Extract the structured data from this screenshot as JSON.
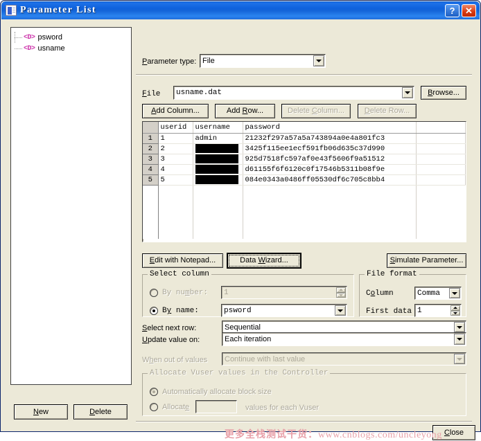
{
  "window": {
    "title": "Parameter List",
    "icon": "document-icon",
    "help_button": "?",
    "close_button": "✕"
  },
  "tree": {
    "items": [
      {
        "icon": "<D>",
        "label": "psword"
      },
      {
        "icon": "<D>",
        "label": "usname"
      }
    ]
  },
  "left_buttons": {
    "new": {
      "label": "New",
      "accel": "N",
      "enabled": true
    },
    "delete": {
      "label": "Delete",
      "accel": "D",
      "enabled": true
    }
  },
  "parameter_type": {
    "label": "Parameter type:",
    "accel": "P",
    "value": "File"
  },
  "file_row": {
    "label": "File",
    "accel": "F",
    "value": "usname.dat",
    "browse": {
      "label": "Browse...",
      "accel": "B"
    }
  },
  "grid_buttons": [
    {
      "label": "Add Column...",
      "accel": "A",
      "enabled": true
    },
    {
      "label": "Add Row...",
      "accel": "R",
      "enabled": true
    },
    {
      "label": "Delete Column...",
      "accel": "C",
      "enabled": false
    },
    {
      "label": "Delete Row...",
      "accel": "D",
      "enabled": false
    }
  ],
  "grid": {
    "columns": [
      "userid",
      "username",
      "password"
    ],
    "rows": [
      {
        "num": "1",
        "userid": "1",
        "username": "admin",
        "username_redacted": false,
        "password": "21232f297a57a5a743894a0e4a801fc3"
      },
      {
        "num": "2",
        "userid": "2",
        "username": "",
        "username_redacted": true,
        "password": "3425f115ee1ecf591fb06d635c37d990"
      },
      {
        "num": "3",
        "userid": "3",
        "username": "",
        "username_redacted": true,
        "password": "925d7518fc597af0e43f5606f9a51512"
      },
      {
        "num": "4",
        "userid": "4",
        "username": "",
        "username_redacted": true,
        "password": "d61155f6f6120c0f17546b5311b08f9e"
      },
      {
        "num": "5",
        "userid": "5",
        "username": "",
        "username_redacted": true,
        "password": "084e0343a0486ff05530df6c705c8bb4"
      }
    ]
  },
  "action_buttons": {
    "edit_notepad": {
      "label": "Edit with Notepad...",
      "accel": "E"
    },
    "data_wizard": {
      "label": "Data Wizard...",
      "accel": "W",
      "focused": true
    },
    "simulate": {
      "label": "Simulate Parameter...",
      "accel": "S"
    }
  },
  "select_column": {
    "title": "Select column",
    "by_number": {
      "label": "By number:",
      "accel": "m",
      "selected": false,
      "enabled": false,
      "value": "1"
    },
    "by_name": {
      "label": "By name:",
      "accel": "y",
      "selected": true,
      "enabled": true,
      "value": "psword"
    }
  },
  "file_format": {
    "title": "File format",
    "column": {
      "label": "Column",
      "accel": "o",
      "value": "Comma"
    },
    "first_data": {
      "label": "First data",
      "value": "1"
    }
  },
  "rows_options": [
    {
      "label": "Select next row:",
      "accel": "S",
      "value": "Sequential",
      "enabled": true
    },
    {
      "label": "Update value on:",
      "accel": "U",
      "value": "Each iteration",
      "enabled": true
    },
    {
      "label": "When out of values",
      "accel": "h",
      "value": "Continue with last value",
      "enabled": false
    }
  ],
  "allocate": {
    "title": "Allocate Vuser values in the Controller",
    "enabled": false,
    "auto": {
      "label": "Automatically allocate block size",
      "selected": true
    },
    "manual": {
      "label_before": "Allocate",
      "accel": "g",
      "value": "",
      "label_after": "values for each Vuser",
      "selected": false
    }
  },
  "bottom": {
    "close": {
      "label": "Close",
      "accel": "C"
    }
  },
  "watermark": {
    "cjk": "更多全栈测试干货：",
    "url": "www.cnblogs.com/uncleyong"
  },
  "colors": {
    "title_bar": "#0f61dc",
    "face": "#ece9d8",
    "close_red": "#d8380f",
    "tree_icon": "#cc33aa",
    "watermark": "#e8a0a8"
  }
}
